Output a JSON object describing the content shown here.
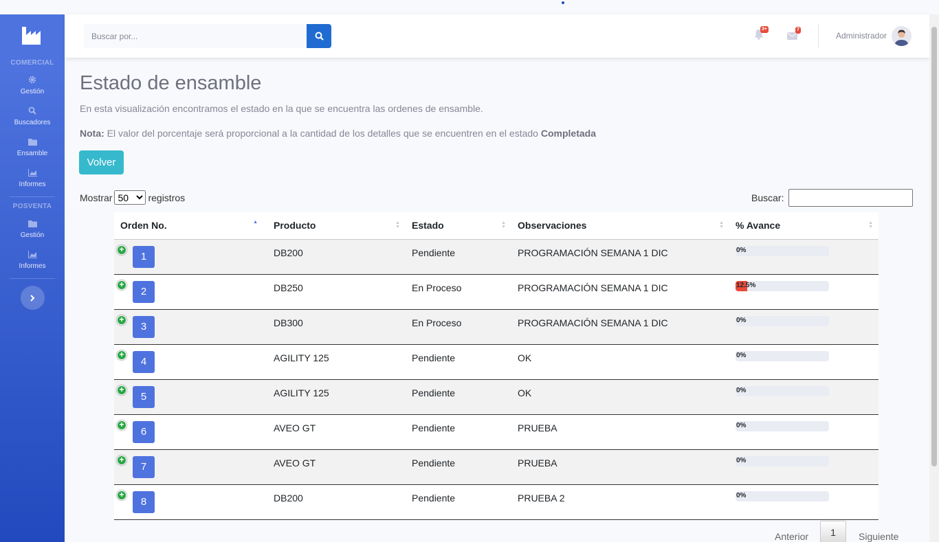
{
  "sidebar": {
    "sections": [
      {
        "heading": "COMERCIAL",
        "items": [
          {
            "label": "Gestión",
            "icon": "gear-icon"
          },
          {
            "label": "Buscadores",
            "icon": "search-icon"
          },
          {
            "label": "Ensamble",
            "icon": "folder-icon"
          },
          {
            "label": "Informes",
            "icon": "chart-area-icon"
          }
        ]
      },
      {
        "heading": "POSVENTA",
        "items": [
          {
            "label": "Gestión",
            "icon": "folder-icon"
          },
          {
            "label": "Informes",
            "icon": "chart-area-icon"
          }
        ]
      }
    ]
  },
  "topbar": {
    "search_placeholder": "Buscar por...",
    "alerts_badge": "3+",
    "messages_badge": "7",
    "user_name": "Administrador"
  },
  "page": {
    "title": "Estado de ensamble",
    "description": "En esta visualización encontramos el estado en la que se encuentra las ordenes de ensamble.",
    "note_label": "Nota:",
    "note_text": " El valor del porcentaje será proporcional a la cantidad de los detalles que se encuentren en el estado ",
    "note_bold": "Completada",
    "back_button": "Volver"
  },
  "table_controls": {
    "show_label": "Mostrar",
    "show_value": "50",
    "show_suffix": "registros",
    "search_label": "Buscar:"
  },
  "table": {
    "headers": [
      "Orden No.",
      "Producto",
      "Estado",
      "Observaciones",
      "% Avance"
    ],
    "rows": [
      {
        "orden": "1",
        "producto": "DB200",
        "estado": "Pendiente",
        "observaciones": "PROGRAMACIÓN SEMANA 1 DIC",
        "avance": "0%",
        "avance_value": 0
      },
      {
        "orden": "2",
        "producto": "DB250",
        "estado": "En Proceso",
        "observaciones": "PROGRAMACIÓN SEMANA 1 DIC",
        "avance": "12.5%",
        "avance_value": 12.5
      },
      {
        "orden": "3",
        "producto": "DB300",
        "estado": "En Proceso",
        "observaciones": "PROGRAMACIÓN SEMANA 1 DIC",
        "avance": "0%",
        "avance_value": 0
      },
      {
        "orden": "4",
        "producto": "AGILITY 125",
        "estado": "Pendiente",
        "observaciones": "OK",
        "avance": "0%",
        "avance_value": 0
      },
      {
        "orden": "5",
        "producto": "AGILITY 125",
        "estado": "Pendiente",
        "observaciones": "OK",
        "avance": "0%",
        "avance_value": 0
      },
      {
        "orden": "6",
        "producto": "AVEO GT",
        "estado": "Pendiente",
        "observaciones": "PRUEBA",
        "avance": "0%",
        "avance_value": 0
      },
      {
        "orden": "7",
        "producto": "AVEO GT",
        "estado": "Pendiente",
        "observaciones": "PRUEBA",
        "avance": "0%",
        "avance_value": 0
      },
      {
        "orden": "8",
        "producto": "DB200",
        "estado": "Pendiente",
        "observaciones": "PRUEBA 2",
        "avance": "0%",
        "avance_value": 0
      }
    ]
  },
  "pagination": {
    "prev": "Anterior",
    "current": "1",
    "next": "Siguiente"
  },
  "colors": {
    "primary": "#4e73df",
    "info": "#36b9cc",
    "danger": "#e74a3b",
    "success": "#28a745"
  }
}
